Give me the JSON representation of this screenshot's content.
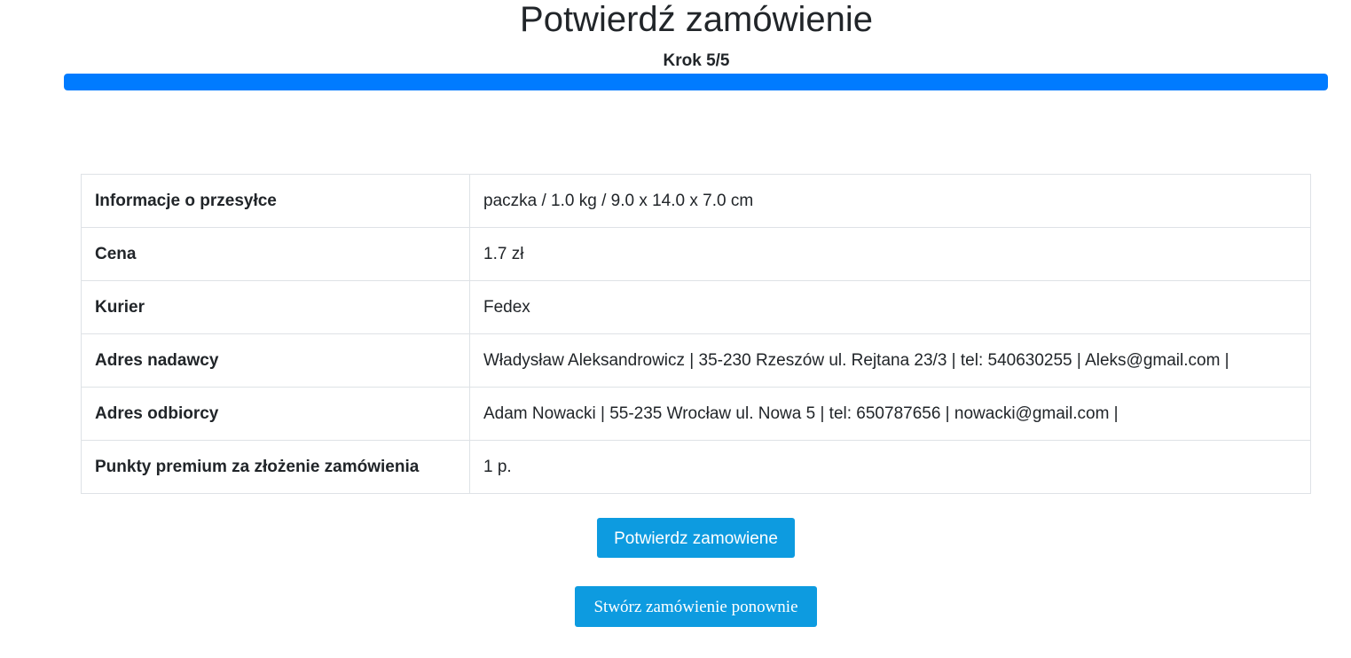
{
  "header": {
    "title": "Potwierdź zamówienie",
    "step_label": "Krok 5/5"
  },
  "progress": {
    "current_step": 5,
    "total_steps": 5,
    "percent": 100,
    "fill_color": "#007bff"
  },
  "summary": {
    "rows": [
      {
        "label": "Informacje o przesyłce",
        "value": "paczka / 1.0 kg / 9.0 x 14.0 x 7.0 cm"
      },
      {
        "label": "Cena",
        "value": "1.7 zł"
      },
      {
        "label": "Kurier",
        "value": "Fedex"
      },
      {
        "label": "Adres nadawcy",
        "value": "Władysław Aleksandrowicz | 35-230 Rzeszów ul. Rejtana 23/3 | tel: 540630255 | Aleks@gmail.com |"
      },
      {
        "label": "Adres odbiorcy",
        "value": "Adam Nowacki | 55-235 Wrocław ul. Nowa 5 | tel: 650787656 | nowacki@gmail.com |"
      },
      {
        "label": "Punkty premium za złożenie zamówienia",
        "value": "1 p."
      }
    ]
  },
  "actions": {
    "confirm_label": "Potwierdz zamowiene",
    "reorder_label": "Stwórz zamówienie ponownie",
    "button_color": "#0d9be0"
  }
}
